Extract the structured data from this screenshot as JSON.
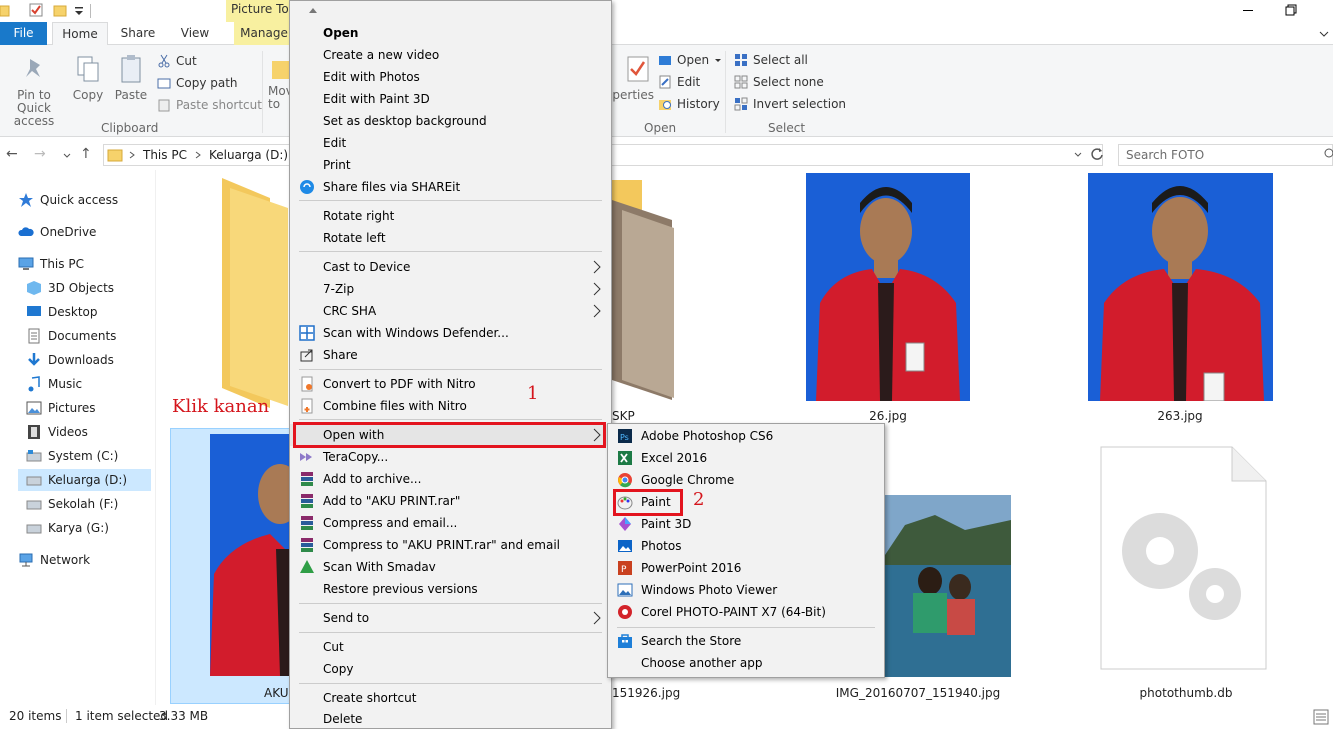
{
  "ribbon": {
    "contextual_tab": "Picture Too",
    "tabs": [
      "File",
      "Home",
      "Share",
      "View",
      "Manage"
    ],
    "pin_label": "Pin to Quick access",
    "copy_label": "Copy",
    "paste_label": "Paste",
    "cut_label": "Cut",
    "copy_path_label": "Copy path",
    "paste_shortcut_label": "Paste shortcut",
    "clipboard_group": "Clipboard",
    "move_label": "Mov",
    "move_label2": "to",
    "properties_label": "perties",
    "open_label": "Open",
    "edit_label": "Edit",
    "history_label": "History",
    "open_group": "Open",
    "select_all_label": "Select all",
    "select_none_label": "Select none",
    "invert_selection_label": "Invert selection",
    "select_group": "Select"
  },
  "address": {
    "crumbs": [
      "This PC",
      "Keluarga (D:)"
    ],
    "search_placeholder": "Search FOTO"
  },
  "nav": {
    "quick_access": "Quick access",
    "onedrive": "OneDrive",
    "this_pc": "This PC",
    "items": [
      "3D Objects",
      "Desktop",
      "Documents",
      "Downloads",
      "Music",
      "Pictures",
      "Videos",
      "System (C:)",
      "Keluarga (D:)",
      "Sekolah (F:)",
      "Karya (G:)"
    ],
    "network": "Network"
  },
  "files": {
    "skp": "SKP",
    "f26": "26.jpg",
    "f263": "263.jpg",
    "aku": "AKU",
    "f151926": "151926.jpg",
    "img151940": "IMG_20160707_151940.jpg",
    "photothumb": "photothumb.db"
  },
  "status": {
    "items": "20 items",
    "selected": "1 item selected",
    "size": "3.33 MB"
  },
  "context_menu": {
    "items": [
      "Open",
      "Create a new video",
      "Edit with Photos",
      "Edit with Paint 3D",
      "Set as desktop background",
      "Edit",
      "Print",
      "Share files via SHAREit",
      "Rotate right",
      "Rotate left",
      "Cast to Device",
      "7-Zip",
      "CRC SHA",
      "Scan with Windows Defender...",
      "Share",
      "Convert to PDF with Nitro",
      "Combine files with Nitro",
      "Open with",
      "TeraCopy...",
      "Add to archive...",
      "Add to \"AKU PRINT.rar\"",
      "Compress and email...",
      "Compress to \"AKU PRINT.rar\" and email",
      "Scan With Smadav",
      "Restore previous versions",
      "Send to",
      "Cut",
      "Copy",
      "Create shortcut",
      "Delete"
    ]
  },
  "open_with_menu": {
    "items": [
      "Adobe Photoshop CS6",
      "Excel 2016",
      "Google Chrome",
      "Paint",
      "Paint 3D",
      "Photos",
      "PowerPoint 2016",
      "Windows Photo Viewer",
      "Corel PHOTO-PAINT X7 (64-Bit)",
      "Search the Store",
      "Choose another app"
    ]
  },
  "annotations": {
    "klik_kanan": "Klik kanan",
    "step1": "1",
    "step2": "2"
  },
  "colors": {
    "accent": "#1979ca",
    "photo_bg": "#1a5fd6",
    "shirt": "#d21c2c",
    "annotation_red": "#e3141e"
  }
}
